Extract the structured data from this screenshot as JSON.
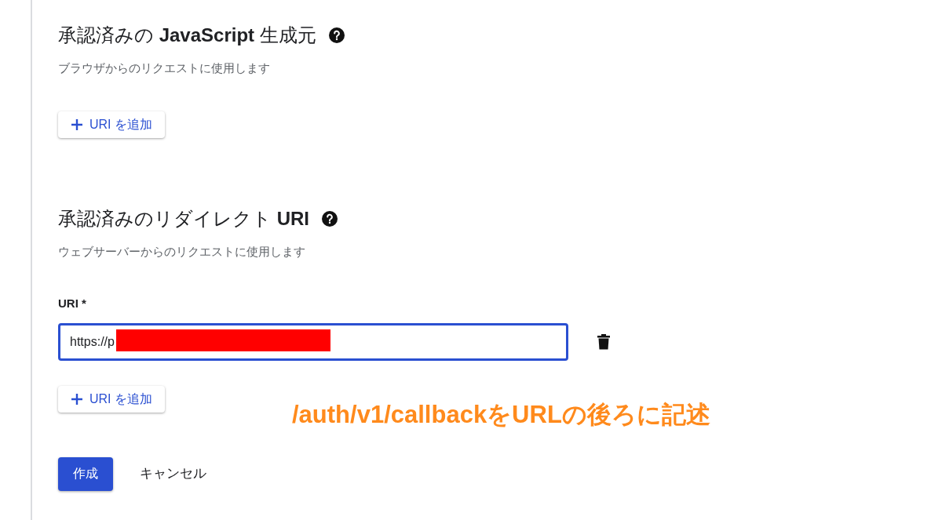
{
  "sections": [
    {
      "title": "承認済みの **JavaScript** 生成元",
      "description": "ブラウザからのリクエストに使用します",
      "add_button": "URI を追加"
    },
    {
      "title": "承認済みのリダイレクト **URI**",
      "description": "ウェブサーバーからのリクエストに使用します",
      "fields": [
        {
          "label": "URI *",
          "value": "https://p",
          "focused": true,
          "redacted": true
        }
      ],
      "add_button": "URI を追加"
    }
  ],
  "annotation": "/auth/v1/callbackをURLの後ろに記述",
  "actions": {
    "primary": "作成",
    "secondary": "キャンセル"
  }
}
